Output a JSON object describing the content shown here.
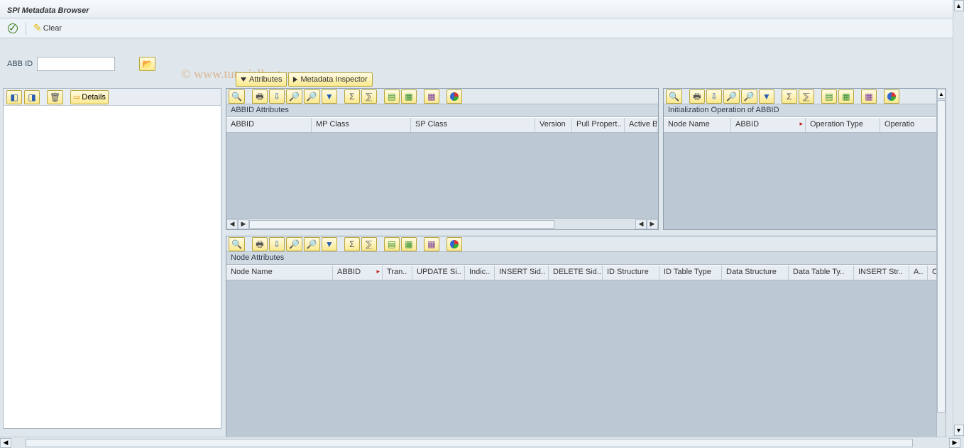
{
  "title": "SPI Metadata Browser",
  "app_toolbar": {
    "execute_tooltip": "Execute",
    "clear_label": "Clear"
  },
  "watermark": "© www.tutorialkart.com",
  "abbid": {
    "label": "ABB ID",
    "value": ""
  },
  "tabs": {
    "attributes": "Attributes",
    "metadata_inspector": "Metadata Inspector"
  },
  "tree": {
    "details_label": "Details"
  },
  "alv1": {
    "caption": "ABBID Attributes",
    "columns": [
      "ABBID",
      "MP Class",
      "SP Class",
      "Version",
      "Pull Propert..",
      "Active B"
    ]
  },
  "alv2": {
    "caption": "Initialization Operation of ABBID",
    "columns": [
      "Node Name",
      "ABBID",
      "Operation Type",
      "Operatio"
    ]
  },
  "alv3": {
    "caption": "Node Attributes",
    "columns": [
      "Node Name",
      "ABBID",
      "Tran..",
      "UPDATE Si..",
      "Indic..",
      "INSERT Sid..",
      "DELETE Sid..",
      "ID Structure",
      "ID Table Type",
      "Data Structure",
      "Data Table Ty..",
      "INSERT Str..",
      "A..",
      "C"
    ]
  },
  "alv_icons": [
    "detail",
    "print",
    "export",
    "find",
    "find-next",
    "filter",
    "sep",
    "sum",
    "subtotal",
    "sep",
    "layout-change",
    "layout-select",
    "sep",
    "layout-grid",
    "sep",
    "chart"
  ]
}
